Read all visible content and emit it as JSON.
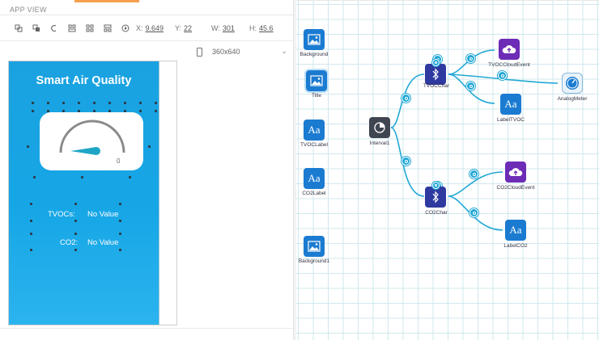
{
  "app_view": {
    "label": "APP VIEW",
    "toolbar": {
      "x_label": "X:",
      "x_value": "9.649",
      "y_label": "Y:",
      "y_value": "22",
      "w_label": "W:",
      "w_value": "301",
      "h_label": "H:",
      "h_value": "45.6"
    },
    "device_select": {
      "value": "360x640"
    },
    "phone": {
      "title": "Smart Air Quality",
      "gauge_value": "0",
      "tvoc_label": "TVOCs:",
      "tvoc_value": "No Value",
      "co2_label": "CO2:",
      "co2_value": "No Value"
    }
  },
  "canvas": {
    "nodes": {
      "background": "Background",
      "title": "Title",
      "tvoc_label": "TVOCLabel",
      "co2_label": "CO2Label",
      "background1": "Background1",
      "interval1": "Interval1",
      "tvoc_char": "TVOCChar",
      "co2_char": "CO2Char",
      "tvoc_cloud_event": "TVOCCloudEvent",
      "co2_cloud_event": "CO2CloudEvent",
      "analog_meter": "AnalogMeter",
      "label_tvoc": "LabelTVOC",
      "label_co2": "LabelCO2"
    }
  },
  "colors": {
    "accent": "#22a8d6",
    "phone_background": "#1aa2e0",
    "tab_highlight": "#f6a04d",
    "node_blue": "#1b7bd1",
    "node_purple": "#6d2cb6",
    "node_navy": "#2e3aa0"
  }
}
